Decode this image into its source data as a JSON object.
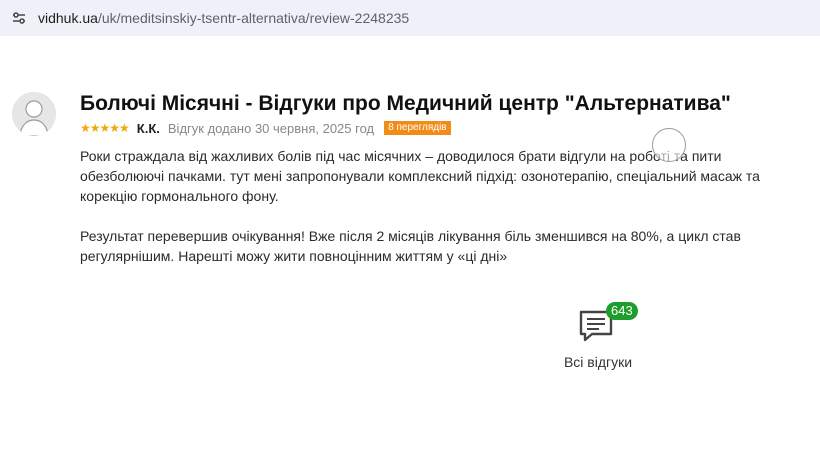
{
  "browser": {
    "url_host": "vidhuk.ua",
    "url_path": "/uk/meditsinskiy-tsentr-alternativa/review-2248235"
  },
  "review": {
    "title": "Болючі Місячні - Відгуки про Медичний центр \"Альтернатива\"",
    "rating": 5,
    "stars": "★★★★★",
    "author": "К.К.",
    "date": "Відгук додано 30 червня, 2025 год",
    "views": "8 переглядів",
    "paragraphs": [
      "Роки страждала від жахливих болів під час місячних – доводилося брати відгули на роботі та пити обезболюючі пачками. тут мені запропонували комплексний підхід: озонотерапію, спеціальний масаж та корекцію гормонального фону.",
      "Результат перевершив очікування! Вже після 2 місяців лікування біль зменшився на 80%, а цикл став регулярнішим. Нарешті можу жити повноцінним життям у «ці дні»"
    ]
  },
  "all_reviews": {
    "count": "643",
    "label": "Всі відгуки",
    "icon": "chat-bubble-icon"
  },
  "colors": {
    "stars": "#f0a90e",
    "views_badge": "#f28c18",
    "count_badge": "#1f9d2c"
  }
}
